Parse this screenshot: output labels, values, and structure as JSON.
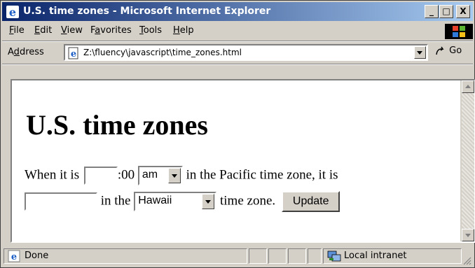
{
  "window": {
    "title": "U.S. time zones - Microsoft Internet Explorer"
  },
  "controls": {
    "minimize": "_",
    "maximize": "□",
    "close": "X"
  },
  "menu": [
    {
      "pre": "",
      "key": "F",
      "post": "ile"
    },
    {
      "pre": "",
      "key": "E",
      "post": "dit"
    },
    {
      "pre": "",
      "key": "V",
      "post": "iew"
    },
    {
      "pre": "F",
      "key": "a",
      "post": "vorites"
    },
    {
      "pre": "",
      "key": "T",
      "post": "ools"
    },
    {
      "pre": "",
      "key": "H",
      "post": "elp"
    }
  ],
  "address": {
    "label_pre": "A",
    "label_key": "d",
    "label_post": "dress",
    "url": "Z:\\fluency\\javascript\\time_zones.html",
    "go_label": "Go"
  },
  "page": {
    "heading": "U.S. time zones",
    "line1_pre": "When it is",
    "minutes_suffix": ":00",
    "ampm_value": "am",
    "line1_post": "in the Pacific time zone, it is",
    "line2_in_the": "in the",
    "zone_value": "Hawaii",
    "line2_post": "time zone.",
    "update_label": "Update",
    "hour_value": "",
    "result_value": ""
  },
  "status": {
    "text": "Done",
    "zone": "Local intranet"
  },
  "icons": [
    "ie-icon",
    "windows-logo-icon",
    "page-icon",
    "go-arrow-icon",
    "scroll-up-icon",
    "scroll-down-icon",
    "intranet-icon",
    "resize-grip-icon"
  ],
  "colors": {
    "titlebar_start": "#0a246a",
    "titlebar_end": "#a6caf0",
    "chrome": "#d4d0c8"
  }
}
